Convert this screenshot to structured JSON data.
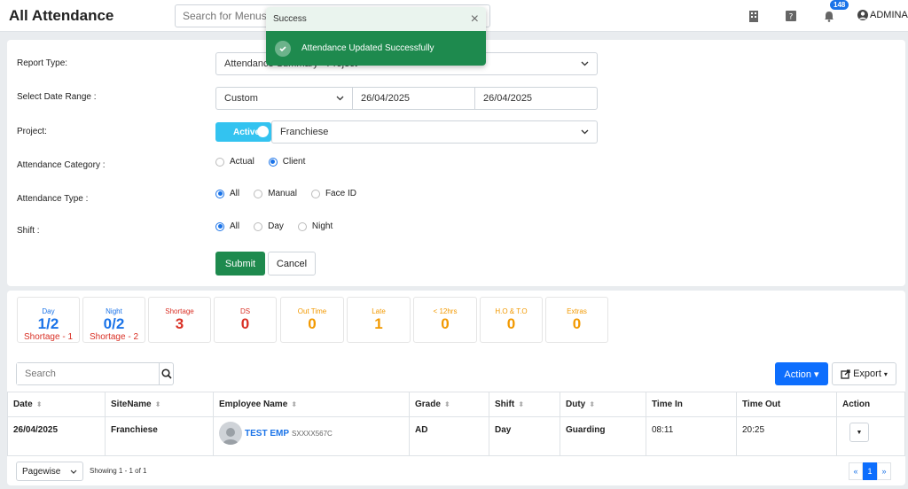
{
  "header": {
    "title": "All Attendance",
    "search_placeholder": "Search for Menus",
    "notification_count": "148",
    "user_name": "ADMINA"
  },
  "toast": {
    "title": "Success",
    "message": "Attendance Updated Successfully",
    "close": "×"
  },
  "form": {
    "report_type_label": "Report Type:",
    "report_type_value": "Attendance Summary - Project",
    "date_range_label": "Select Date Range :",
    "date_range_value": "Custom",
    "date_from": "26/04/2025",
    "date_to": "26/04/2025",
    "project_label": "Project:",
    "toggle_label": "Active",
    "project_value": "Franchiese",
    "category_label": "Attendance Category :",
    "category_options": [
      "Actual",
      "Client"
    ],
    "category_selected": "Client",
    "type_label": "Attendance Type :",
    "type_options": [
      "All",
      "Manual",
      "Face ID"
    ],
    "type_selected": "All",
    "shift_label": "Shift :",
    "shift_options": [
      "All",
      "Day",
      "Night"
    ],
    "shift_selected": "All",
    "submit_label": "Submit",
    "cancel_label": "Cancel"
  },
  "stats": [
    {
      "title": "Day",
      "value": "1/2",
      "sub": "Shortage - 1",
      "color": "#1a73e8"
    },
    {
      "title": "Night",
      "value": "0/2",
      "sub": "Shortage - 2",
      "color": "#1a73e8"
    },
    {
      "title": "Shortage",
      "value": "3",
      "sub": "",
      "color": "#d93025"
    },
    {
      "title": "DS",
      "value": "0",
      "sub": "",
      "color": "#d93025"
    },
    {
      "title": "Out Time",
      "value": "0",
      "sub": "",
      "color": "#f29900"
    },
    {
      "title": "Late",
      "value": "1",
      "sub": "",
      "color": "#f29900"
    },
    {
      "title": "< 12hrs",
      "value": "0",
      "sub": "",
      "color": "#f29900"
    },
    {
      "title": "H.O & T.O",
      "value": "0",
      "sub": "",
      "color": "#f29900"
    },
    {
      "title": "Extras",
      "value": "0",
      "sub": "",
      "color": "#f29900"
    }
  ],
  "table_tools": {
    "search_placeholder": "Search",
    "action_label": "Action",
    "export_label": "Export"
  },
  "table": {
    "columns": [
      "Date",
      "SiteName",
      "Employee Name",
      "Grade",
      "Shift",
      "Duty",
      "Time In",
      "Time Out",
      "Action"
    ],
    "rows": [
      {
        "date": "26/04/2025",
        "site": "Franchiese",
        "employee_name": "TEST EMP",
        "employee_code": "SXXXX567C",
        "grade": "AD",
        "shift": "Day",
        "duty": "Guarding",
        "time_in": "08:11",
        "time_out": "20:25"
      }
    ]
  },
  "footer": {
    "pagewise_label": "Pagewise",
    "showing_text": "Showing 1 - 1 of 1",
    "prev": "«",
    "page": "1",
    "next": "»"
  },
  "colors": {
    "success": "#1e8a4e",
    "primary": "#0d6efd",
    "toggle": "#33c3f0",
    "danger": "#d93025",
    "warning": "#f29900"
  }
}
